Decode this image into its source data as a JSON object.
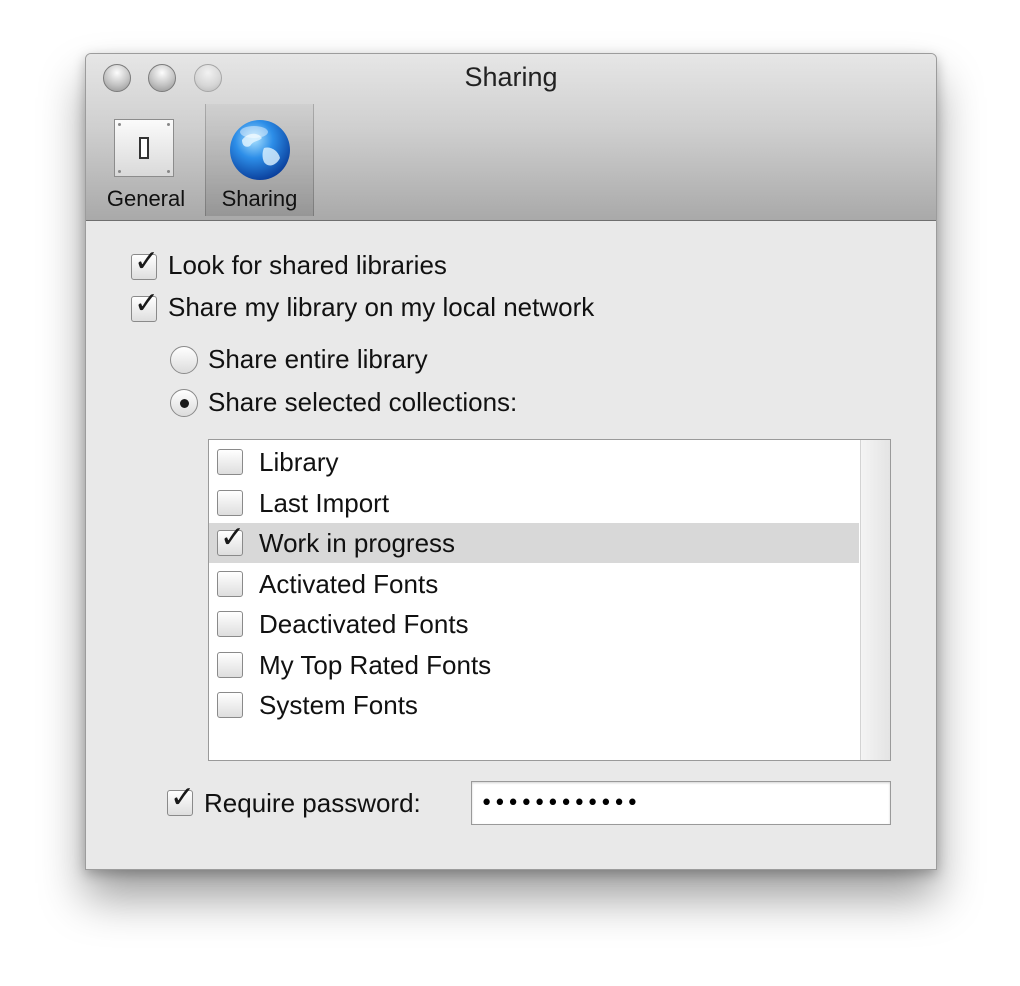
{
  "window": {
    "title": "Sharing"
  },
  "toolbar": {
    "items": [
      {
        "label": "General",
        "icon": "switch-icon",
        "selected": false
      },
      {
        "label": "Sharing",
        "icon": "globe-icon",
        "selected": true
      }
    ]
  },
  "options": {
    "look_for_shared": {
      "label": "Look for shared libraries",
      "checked": true
    },
    "share_library": {
      "label": "Share my library on my local network",
      "checked": true
    },
    "share_entire": {
      "label": "Share entire library",
      "selected": false
    },
    "share_selected": {
      "label": "Share selected collections:",
      "selected": true
    }
  },
  "collections": [
    {
      "label": "Library",
      "checked": false
    },
    {
      "label": "Last Import",
      "checked": false
    },
    {
      "label": "Work in progress",
      "checked": true
    },
    {
      "label": "Activated Fonts",
      "checked": false
    },
    {
      "label": "Deactivated Fonts",
      "checked": false
    },
    {
      "label": "My Top Rated Fonts",
      "checked": false
    },
    {
      "label": "System Fonts",
      "checked": false
    }
  ],
  "password": {
    "label": "Require password:",
    "checked": true,
    "value": "••••••••••••"
  },
  "colors": {
    "highlight_row": "#d8d8d8",
    "window_bg": "#e9e9e9"
  }
}
